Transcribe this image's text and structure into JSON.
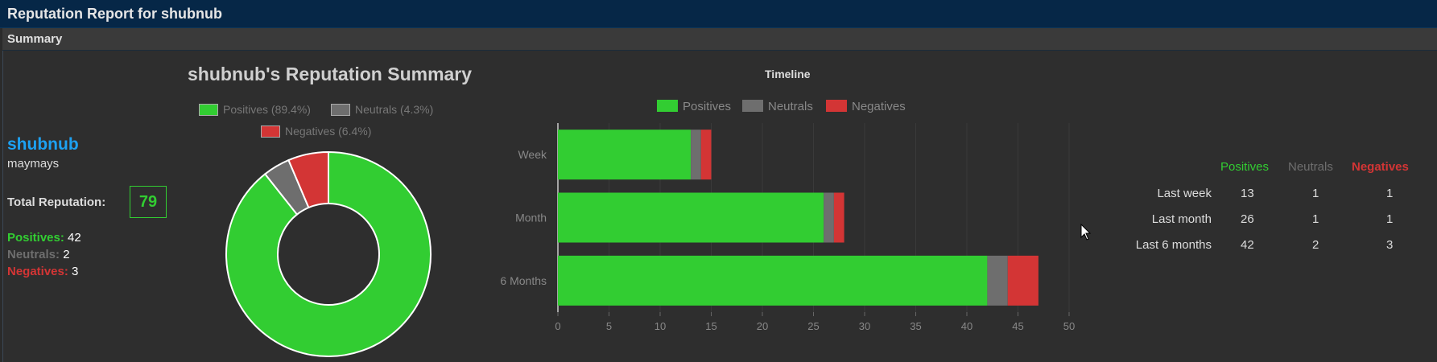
{
  "header": {
    "title": "Reputation Report for shubnub"
  },
  "subheader": {
    "title": "Summary"
  },
  "user": {
    "name": "shubnub",
    "title": "maymays"
  },
  "total": {
    "label": "Total Reputation:",
    "value": "79"
  },
  "stats": {
    "positives_label": "Positives:",
    "positives_value": "42",
    "neutrals_label": "Neutrals:",
    "neutrals_value": "2",
    "negatives_label": "Negatives:",
    "negatives_value": "3"
  },
  "colors": {
    "positive": "#32cd32",
    "neutral": "#6e6e6e",
    "negative": "#d33535",
    "link": "#1da1f2"
  },
  "donut": {
    "title": "shubnub's Reputation Summary",
    "legend": [
      "Positives (89.4%)",
      "Neutrals (4.3%)",
      "Negatives (6.4%)"
    ]
  },
  "chart_data": [
    {
      "type": "pie",
      "title": "shubnub's Reputation Summary",
      "categories": [
        "Positives",
        "Neutrals",
        "Negatives"
      ],
      "values": [
        42,
        2,
        3
      ],
      "percent_labels": [
        "89.4%",
        "4.3%",
        "6.4%"
      ],
      "donut": true,
      "legend": "top"
    },
    {
      "type": "bar",
      "orientation": "horizontal",
      "stacked": true,
      "title": "Timeline",
      "categories": [
        "Week",
        "Month",
        "6 Months"
      ],
      "series": [
        {
          "name": "Positives",
          "values": [
            13,
            26,
            42
          ]
        },
        {
          "name": "Neutrals",
          "values": [
            1,
            1,
            2
          ]
        },
        {
          "name": "Negatives",
          "values": [
            1,
            1,
            3
          ]
        }
      ],
      "xlim": [
        0,
        50
      ],
      "xticks": [
        0,
        5,
        10,
        15,
        20,
        25,
        30,
        35,
        40,
        45,
        50
      ],
      "grid": true,
      "legend": "top"
    }
  ],
  "table": {
    "headers": [
      "Positives",
      "Neutrals",
      "Negatives"
    ],
    "rows": [
      {
        "label": "Last week",
        "values": [
          "13",
          "1",
          "1"
        ]
      },
      {
        "label": "Last month",
        "values": [
          "26",
          "1",
          "1"
        ]
      },
      {
        "label": "Last 6 months",
        "values": [
          "42",
          "2",
          "3"
        ]
      }
    ]
  }
}
